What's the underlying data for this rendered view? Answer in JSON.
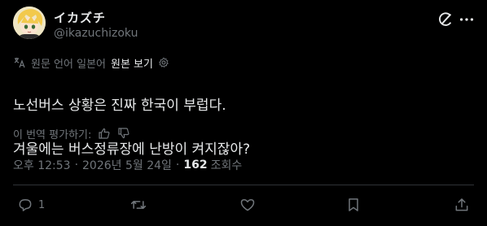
{
  "author": {
    "name": "イカズチ",
    "handle": "@ikazuchizoku"
  },
  "translation": {
    "translated_from": "원문 언어 일본어",
    "show_original": "원본 보기"
  },
  "tweet": {
    "line1": "노선버스 상황은 진짜 한국이 부럽다.",
    "line2": "겨울에는 버스정류장에 난방이 켜지잖아?"
  },
  "rating": {
    "label": "이 번역 평가하기:"
  },
  "meta": {
    "time": "오후 12:53",
    "date": "2026년 5월 24일",
    "views": "162",
    "views_label": "조회수"
  },
  "actions": {
    "reply_count": "1"
  },
  "icons": {
    "top": [
      "grok-icon",
      "more-icon"
    ],
    "actions": [
      "reply-icon",
      "retweet-icon",
      "like-icon",
      "bookmark-icon",
      "share-icon"
    ]
  },
  "colors": {
    "background": "#000000",
    "text": "#e7e9ea",
    "muted": "#71767b",
    "divider": "#2f3336"
  }
}
